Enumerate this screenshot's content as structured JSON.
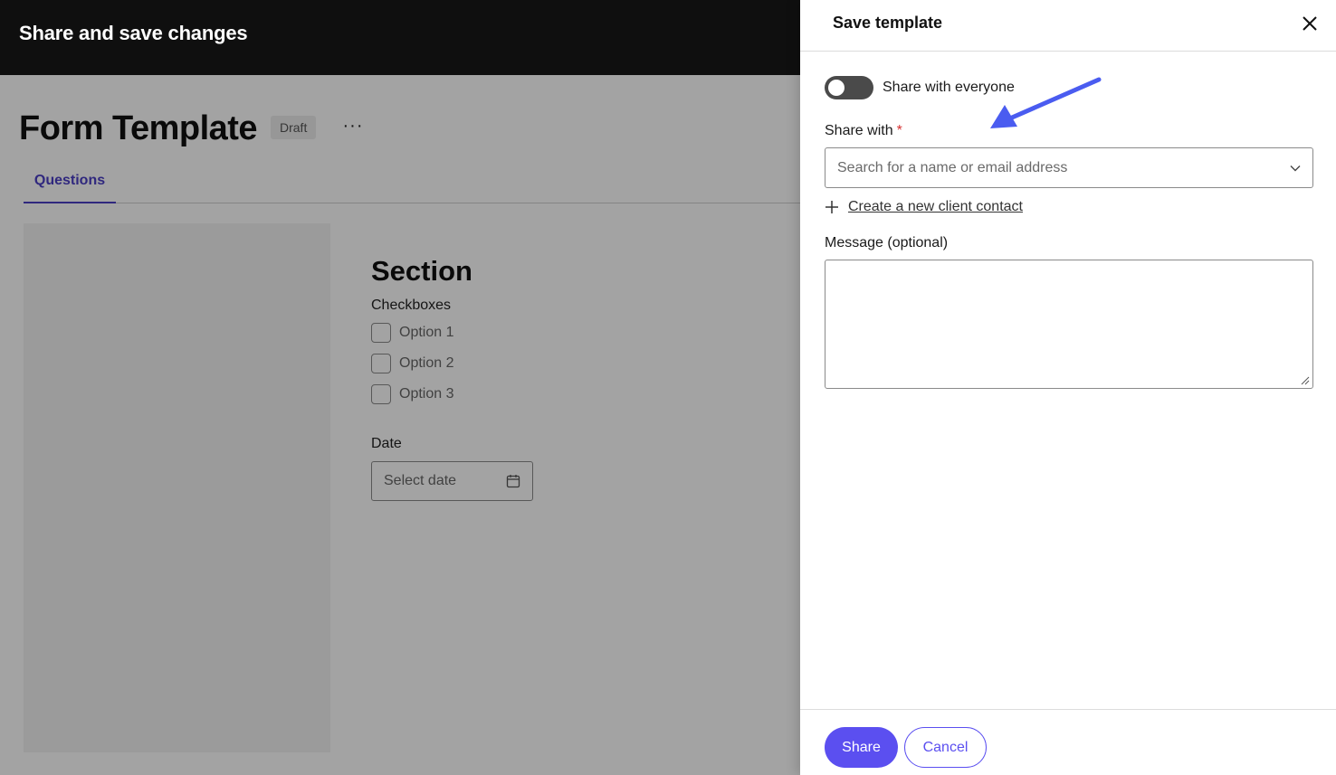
{
  "topbar": {
    "title": "Share and save changes"
  },
  "page": {
    "title": "Form Template",
    "status_badge": "Draft",
    "more_label": "···",
    "tabs": [
      {
        "label": "Questions",
        "active": true
      }
    ]
  },
  "form": {
    "section_title": "Section",
    "checkboxes_label": "Checkboxes",
    "options": [
      "Option 1",
      "Option 2",
      "Option 3"
    ],
    "date_label": "Date",
    "date_placeholder": "Select date"
  },
  "drawer": {
    "title": "Save template",
    "close_icon": "close-icon",
    "toggle": {
      "label": "Share with everyone",
      "on": false
    },
    "share_with": {
      "label": "Share with",
      "required_mark": "*",
      "placeholder": "Search for a name or email address",
      "value": ""
    },
    "create_contact_link": "Create a new client contact",
    "message": {
      "label": "Message (optional)",
      "value": ""
    },
    "buttons": {
      "share": "Share",
      "cancel": "Cancel"
    }
  },
  "colors": {
    "accent": "#5b4ff0",
    "tab_active": "#4b3fc6",
    "annotation_arrow": "#4a5cf0",
    "topbar": "#0f0f0f",
    "required": "#d63030"
  }
}
